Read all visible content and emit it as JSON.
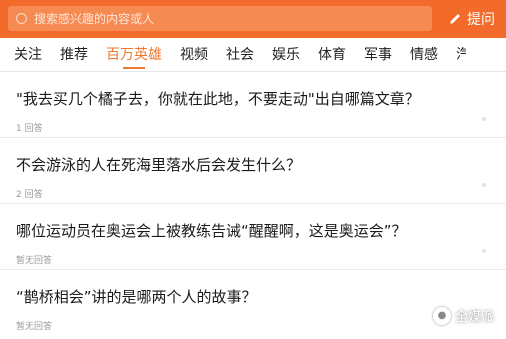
{
  "search": {
    "placeholder": "搜索感兴趣的内容或人"
  },
  "ask_button": {
    "label": "提问"
  },
  "tabs": [
    {
      "label": "关注",
      "active": false
    },
    {
      "label": "推荐",
      "active": false
    },
    {
      "label": "百万英雄",
      "active": true
    },
    {
      "label": "视频",
      "active": false
    },
    {
      "label": "社会",
      "active": false
    },
    {
      "label": "娱乐",
      "active": false
    },
    {
      "label": "体育",
      "active": false
    },
    {
      "label": "军事",
      "active": false
    },
    {
      "label": "情感",
      "active": false
    },
    {
      "label": "汽",
      "active": false
    }
  ],
  "questions": [
    {
      "title": "\"我去买几个橘子去，你就在此地，不要走动\"出自哪篇文章？",
      "meta": "1 回答"
    },
    {
      "title": "不会游泳的人在死海里落水后会发生什么？",
      "meta": "2 回答"
    },
    {
      "title": "哪位运动员在奥运会上被教练告诫“醒醒啊，这是奥运会”？",
      "meta": "暂无回答"
    },
    {
      "title": "“鹊桥相会”讲的是哪两个人的故事？",
      "meta": "暂无回答"
    }
  ],
  "watermark": {
    "text": "全媒派"
  },
  "colors": {
    "brand": "#f26b2b",
    "active_tab": "#f0772e"
  }
}
